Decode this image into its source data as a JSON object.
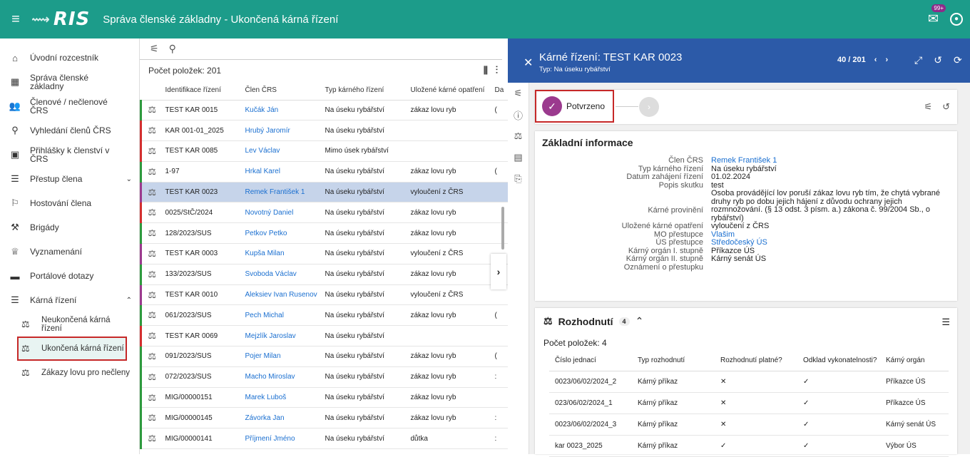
{
  "header": {
    "logo": "RIS",
    "title": "Správa členské základny - Ukončená kárná řízení",
    "mail_badge": "99+"
  },
  "sidebar": {
    "items": [
      {
        "label": "Úvodní rozcestník",
        "icon": "home-icon"
      },
      {
        "label": "Správa členské základny",
        "icon": "dashboard-icon"
      },
      {
        "label": "Členové / nečlenové ČRS",
        "icon": "people-icon"
      },
      {
        "label": "Vyhledání členů ČRS",
        "icon": "search-icon"
      },
      {
        "label": "Přihlášky k členství v ČRS",
        "icon": "application-icon"
      },
      {
        "label": "Přestup člena",
        "icon": "list-icon"
      },
      {
        "label": "Hostování člena",
        "icon": "guest-icon"
      },
      {
        "label": "Brigády",
        "icon": "tools-icon"
      },
      {
        "label": "Vyznamenání",
        "icon": "trophy-icon"
      },
      {
        "label": "Portálové dotazy",
        "icon": "chat-icon"
      },
      {
        "label": "Kárná řízení",
        "icon": "list-icon"
      }
    ],
    "subitems": [
      {
        "label": "Neukončená kárná řízení"
      },
      {
        "label": "Ukončená kárná řízení"
      },
      {
        "label": "Zákazy lovu pro nečleny"
      }
    ]
  },
  "list": {
    "count_label": "Počet položek: 201",
    "columns": [
      "Identifikace řízení",
      "Člen ČRS",
      "Typ kárného řízení",
      "Uložené kárné opatření",
      "Da"
    ],
    "rows": [
      {
        "id": "TEST KAR 0015",
        "member": "Kučák Ján",
        "type": "Na úseku rybářství",
        "measure": "zákaz lovu ryb",
        "extra": "(",
        "color": "#2e9a3e"
      },
      {
        "id": "KAR 001-01_2025",
        "member": "Hrubý Jaromír",
        "type": "Na úseku rybářství",
        "measure": "",
        "extra": "",
        "color": "#d32f2f"
      },
      {
        "id": "TEST KAR 0085",
        "member": "Lev Václav",
        "type": "Mimo úsek rybářství",
        "measure": "",
        "extra": "",
        "color": "#d32f2f"
      },
      {
        "id": "1-97",
        "member": "Hrkal Karel",
        "type": "Na úseku rybářství",
        "measure": "zákaz lovu ryb",
        "extra": "(",
        "color": "#2e9a3e"
      },
      {
        "id": "TEST KAR 0023",
        "member": "Remek František 1",
        "type": "Na úseku rybářství",
        "measure": "vyloučení z ČRS",
        "extra": "",
        "color": "#9b3a8e"
      },
      {
        "id": "0025/StČ/2024",
        "member": "Novotný Daniel",
        "type": "Na úseku rybářství",
        "measure": "zákaz lovu ryb",
        "extra": "",
        "color": "#d32f2f"
      },
      {
        "id": "128/2023/SUS",
        "member": "Petkov Petko",
        "type": "Na úseku rybářství",
        "measure": "zákaz lovu ryb",
        "extra": "",
        "color": "#2e9a3e"
      },
      {
        "id": "TEST KAR 0003",
        "member": "Kupša Milan",
        "type": "Na úseku rybářství",
        "measure": "vyloučení z ČRS",
        "extra": "",
        "color": "#9b3a8e"
      },
      {
        "id": "133/2023/SUS",
        "member": "Svoboda Václav",
        "type": "Na úseku rybářství",
        "measure": "zákaz lovu ryb",
        "extra": "",
        "color": "#2e9a3e"
      },
      {
        "id": "TEST KAR 0010",
        "member": "Aleksiev Ivan Rusenov",
        "type": "Na úseku rybářství",
        "measure": "vyloučení z ČRS",
        "extra": "",
        "color": "#9b3a8e"
      },
      {
        "id": "061/2023/SUS",
        "member": "Pech Michal",
        "type": "Na úseku rybářství",
        "measure": "zákaz lovu ryb",
        "extra": "(",
        "color": "#2e9a3e"
      },
      {
        "id": "TEST KAR 0069",
        "member": "Mejzlík Jaroslav",
        "type": "Na úseku rybářství",
        "measure": "",
        "extra": "",
        "color": "#d32f2f"
      },
      {
        "id": "091/2023/SUS",
        "member": "Pojer Milan",
        "type": "Na úseku rybářství",
        "measure": "zákaz lovu ryb",
        "extra": "(",
        "color": "#2e9a3e"
      },
      {
        "id": "072/2023/SUS",
        "member": "Macho Miroslav",
        "type": "Na úseku rybářství",
        "measure": "zákaz lovu ryb",
        "extra": ":",
        "color": "#2e9a3e"
      },
      {
        "id": "MIG/00000151",
        "member": "Marek Luboš",
        "type": "Na úseku rybářství",
        "measure": "zákaz lovu ryb",
        "extra": "",
        "color": "#2e9a3e"
      },
      {
        "id": "MIG/00000145",
        "member": "Závorka Jan",
        "type": "Na úseku rybářství",
        "measure": "zákaz lovu ryb",
        "extra": ":",
        "color": "#2e9a3e"
      },
      {
        "id": "MIG/00000141",
        "member": "Příjmení Jméno",
        "type": "Na úseku rybářství",
        "measure": "důtka",
        "extra": ":",
        "color": "#2e9a3e"
      }
    ]
  },
  "detail": {
    "title": "Kárné řízení: TEST KAR 0023",
    "subtitle": "Typ: Na úseku rybářství",
    "pager": "40 / 201",
    "step_label": "Potvrzeno",
    "info_title": "Základní informace",
    "fields": [
      {
        "label": "Člen ČRS",
        "value": "Remek František 1",
        "link": true
      },
      {
        "label": "Typ kárného řízení",
        "value": "Na úseku rybářství"
      },
      {
        "label": "Datum zahájení řízení",
        "value": "01.02.2024"
      },
      {
        "label": "Popis skutku",
        "value": "test"
      },
      {
        "label": "Kárné provinění",
        "value": "Osoba provádějící lov poruší zákaz lovu ryb tím, že chytá vybrané druhy ryb po dobu jejich hájení z důvodu ochrany jejich rozmnožování. (§ 13 odst. 3 písm. a.) zákona č. 99/2004 Sb., o rybářství)"
      },
      {
        "label": "Uložené kárné opatření",
        "value": "vyloučení z ČRS"
      },
      {
        "label": "MO přestupce",
        "value": "Vlašim",
        "link": true
      },
      {
        "label": "ÚS přestupce",
        "value": "Středočeský ÚS",
        "link": true
      },
      {
        "label": "Kárný orgán I. stupně",
        "value": "Příkazce ÚS"
      },
      {
        "label": "Kárný orgán II. stupně",
        "value": "Kárný senát ÚS"
      },
      {
        "label": "Oznámení o přestupku",
        "value": ""
      }
    ],
    "decisions": {
      "title": "Rozhodnutí",
      "count": "4",
      "count_label": "Počet položek: 4",
      "columns": [
        "Číslo jednací",
        "Typ rozhodnutí",
        "Rozhodnutí platné?",
        "Odklad vykonatelnosti?",
        "Kárný orgán"
      ],
      "rows": [
        {
          "cj": "0023/06/02/2024_2",
          "type": "Kárný příkaz",
          "valid": "✕",
          "odklad": "✓",
          "organ": "Příkazce ÚS"
        },
        {
          "cj": "023/06/02/2024_1",
          "type": "Kárný příkaz",
          "valid": "✕",
          "odklad": "✓",
          "organ": "Příkazce ÚS"
        },
        {
          "cj": "0023/06/02/2024_3",
          "type": "Kárný příkaz",
          "valid": "✕",
          "odklad": "✓",
          "organ": "Kárný senát ÚS"
        },
        {
          "cj": "kar 0023_2025",
          "type": "Kárný příkaz",
          "valid": "✓",
          "odklad": "✓",
          "organ": "Výbor ÚS"
        }
      ]
    }
  }
}
